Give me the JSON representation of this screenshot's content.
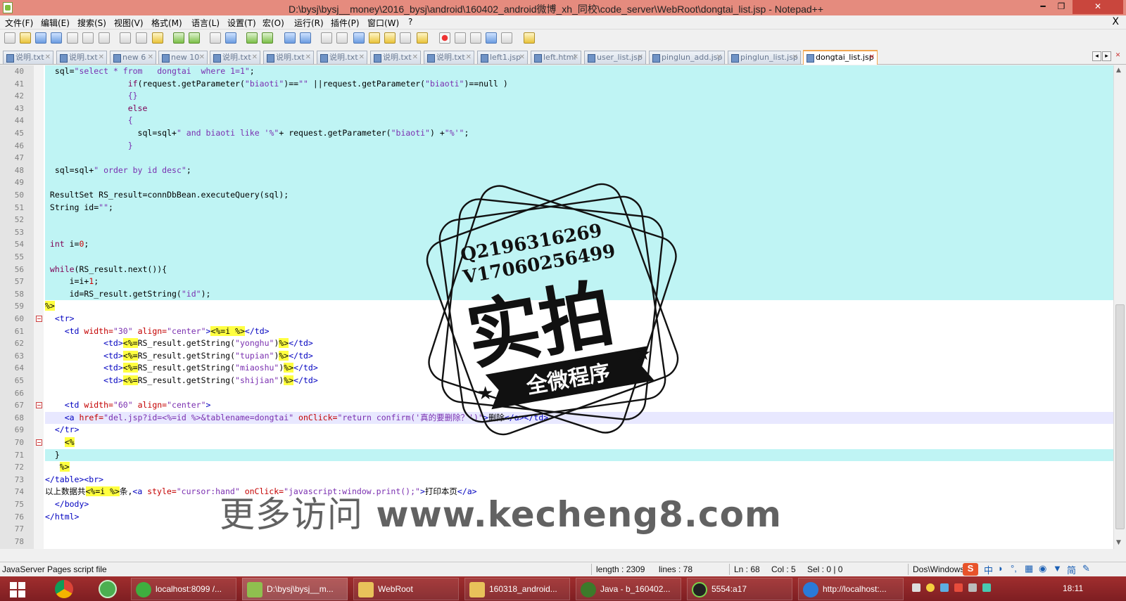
{
  "window": {
    "title": "D:\\bysj\\bysj__money\\2016_bysj\\android\\160402_android微博_xh_同校\\code_server\\WebRoot\\dongtai_list.jsp - Notepad++",
    "minimize": "━",
    "restore": "❐",
    "close": "✕"
  },
  "menu": {
    "items": [
      "文件(F)",
      "编辑(E)",
      "搜索(S)",
      "视图(V)",
      "格式(M)",
      "语言(L)",
      "设置(T)",
      "宏(O)",
      "运行(R)",
      "插件(P)",
      "窗口(W)",
      "?"
    ],
    "close_doc": "X"
  },
  "tabs": [
    {
      "label": "说明.txt"
    },
    {
      "label": "说明.txt"
    },
    {
      "label": "new 6"
    },
    {
      "label": "new 10"
    },
    {
      "label": "说明.txt"
    },
    {
      "label": "说明.txt"
    },
    {
      "label": "说明.txt"
    },
    {
      "label": "说明.txt"
    },
    {
      "label": "说明.txt"
    },
    {
      "label": "left1.jsp"
    },
    {
      "label": "left.html"
    },
    {
      "label": "user_list.jsp"
    },
    {
      "label": "pinglun_add.jsp"
    },
    {
      "label": "pinglun_list.jsp"
    },
    {
      "label": "dongtai_list.jsp",
      "active": true
    }
  ],
  "tab_close_glyph": "✕",
  "tab_nav": {
    "prev": "◂",
    "next": "▸",
    "close": "✕"
  },
  "editor": {
    "lines": [
      {
        "n": "40",
        "hl": true,
        "segs": [
          [
            "tx",
            "  sql="
          ],
          [
            "str",
            "\"select * from   dongtai  where 1=1\""
          ],
          [
            "tx",
            ";"
          ]
        ]
      },
      {
        "n": "41",
        "hl": true,
        "segs": [
          [
            "tx",
            "                 "
          ],
          [
            "kw",
            "if"
          ],
          [
            "tx",
            "(request.getParameter("
          ],
          [
            "str",
            "\"biaoti\""
          ],
          [
            "tx",
            ")=="
          ],
          [
            "str",
            "\"\""
          ],
          [
            "tx",
            " ||request.getParameter("
          ],
          [
            "str",
            "\"biaoti\""
          ],
          [
            "tx",
            ")==null )"
          ]
        ]
      },
      {
        "n": "42",
        "hl": true,
        "segs": [
          [
            "tx",
            "                 "
          ],
          [
            "str",
            "{}"
          ]
        ]
      },
      {
        "n": "43",
        "hl": true,
        "segs": [
          [
            "tx",
            "                 "
          ],
          [
            "kw",
            "else"
          ]
        ]
      },
      {
        "n": "44",
        "hl": true,
        "segs": [
          [
            "tx",
            "                 "
          ],
          [
            "str",
            "{"
          ]
        ]
      },
      {
        "n": "45",
        "hl": true,
        "segs": [
          [
            "tx",
            "                   sql=sql+"
          ],
          [
            "str",
            "\" and biaoti like '%\""
          ],
          [
            "tx",
            "+ request.getParameter("
          ],
          [
            "str",
            "\"biaoti\""
          ],
          [
            "tx",
            ") +"
          ],
          [
            "str",
            "\"%'\""
          ],
          [
            "tx",
            ";"
          ]
        ]
      },
      {
        "n": "46",
        "hl": true,
        "segs": [
          [
            "tx",
            "                 "
          ],
          [
            "str",
            "}"
          ]
        ]
      },
      {
        "n": "47",
        "hl": true,
        "segs": []
      },
      {
        "n": "48",
        "hl": true,
        "segs": [
          [
            "tx",
            "  sql=sql+"
          ],
          [
            "str",
            "\" order by id desc\""
          ],
          [
            "tx",
            ";"
          ]
        ]
      },
      {
        "n": "49",
        "hl": true,
        "segs": []
      },
      {
        "n": "50",
        "hl": true,
        "segs": [
          [
            "tx",
            " ResultSet RS_result=connDbBean.executeQuery(sql);"
          ]
        ]
      },
      {
        "n": "51",
        "hl": true,
        "segs": [
          [
            "tx",
            " String id="
          ],
          [
            "str",
            "\"\""
          ],
          [
            "tx",
            ";"
          ]
        ]
      },
      {
        "n": "52",
        "hl": true,
        "segs": []
      },
      {
        "n": "53",
        "hl": true,
        "segs": []
      },
      {
        "n": "54",
        "hl": true,
        "segs": [
          [
            "kw",
            " int"
          ],
          [
            "tx",
            " i="
          ],
          [
            "num",
            "0"
          ],
          [
            "tx",
            ";"
          ]
        ]
      },
      {
        "n": "55",
        "hl": true,
        "segs": []
      },
      {
        "n": "56",
        "hl": true,
        "segs": [
          [
            "kw",
            " while"
          ],
          [
            "tx",
            "(RS_result.next()){"
          ]
        ]
      },
      {
        "n": "57",
        "hl": true,
        "segs": [
          [
            "tx",
            "     i=i+"
          ],
          [
            "num",
            "1"
          ],
          [
            "tx",
            ";"
          ]
        ]
      },
      {
        "n": "58",
        "hl": true,
        "segs": [
          [
            "tx",
            "     id=RS_result.getString("
          ],
          [
            "str",
            "\"id\""
          ],
          [
            "tx",
            ");"
          ]
        ]
      },
      {
        "n": "59",
        "hl": false,
        "segs": [
          [
            "tk",
            "%>"
          ]
        ]
      },
      {
        "n": "60",
        "hl": false,
        "fold": true,
        "segs": [
          [
            "tag",
            "  <tr>"
          ]
        ]
      },
      {
        "n": "61",
        "hl": false,
        "segs": [
          [
            "tag",
            "    <td "
          ],
          [
            "attr",
            "width="
          ],
          [
            "str",
            "\"30\""
          ],
          [
            "attr",
            " align="
          ],
          [
            "str",
            "\"center\""
          ],
          [
            "tag",
            ">"
          ],
          [
            "tk",
            "<%=i "
          ],
          [
            "tk",
            "%>"
          ],
          [
            "tag",
            "</td>"
          ]
        ]
      },
      {
        "n": "62",
        "hl": false,
        "segs": [
          [
            "tag",
            "            <td>"
          ],
          [
            "tk",
            "<%="
          ],
          [
            "tx",
            "RS_result.getString("
          ],
          [
            "str",
            "\"yonghu\""
          ],
          [
            "tx",
            ")"
          ],
          [
            "tk",
            "%>"
          ],
          [
            "tag",
            "</td>"
          ]
        ]
      },
      {
        "n": "63",
        "hl": false,
        "segs": [
          [
            "tag",
            "            <td>"
          ],
          [
            "tk",
            "<%="
          ],
          [
            "tx",
            "RS_result.getString("
          ],
          [
            "str",
            "\"tupian\""
          ],
          [
            "tx",
            ")"
          ],
          [
            "tk",
            "%>"
          ],
          [
            "tag",
            "</td>"
          ]
        ]
      },
      {
        "n": "64",
        "hl": false,
        "segs": [
          [
            "tag",
            "            <td>"
          ],
          [
            "tk",
            "<%="
          ],
          [
            "tx",
            "RS_result.getString("
          ],
          [
            "str",
            "\"miaoshu\""
          ],
          [
            "tx",
            ")"
          ],
          [
            "tk",
            "%>"
          ],
          [
            "tag",
            "</td>"
          ]
        ]
      },
      {
        "n": "65",
        "hl": false,
        "segs": [
          [
            "tag",
            "            <td>"
          ],
          [
            "tk",
            "<%="
          ],
          [
            "tx",
            "RS_result.getString("
          ],
          [
            "str",
            "\"shijian\""
          ],
          [
            "tx",
            ")"
          ],
          [
            "tk",
            "%>"
          ],
          [
            "tag",
            "</td>"
          ]
        ]
      },
      {
        "n": "66",
        "hl": false,
        "segs": []
      },
      {
        "n": "67",
        "hl": false,
        "fold": true,
        "segs": [
          [
            "tag",
            "    <td "
          ],
          [
            "attr",
            "width="
          ],
          [
            "str",
            "\"60\""
          ],
          [
            "attr",
            " align="
          ],
          [
            "str",
            "\"center\""
          ],
          [
            "tag",
            ">"
          ]
        ]
      },
      {
        "n": "68",
        "hl": false,
        "cur": true,
        "segs": [
          [
            "tag",
            "    <a "
          ],
          [
            "attr",
            "href="
          ],
          [
            "str",
            "\"del.jsp?id=<%=id %>&tablename=dongtai\""
          ],
          [
            "attr",
            " onClick="
          ],
          [
            "str",
            "\"return confirm('真的要删除？')\""
          ],
          [
            "tag",
            ">"
          ],
          [
            "tx",
            "删除"
          ],
          [
            "tag",
            "</a></td>"
          ]
        ]
      },
      {
        "n": "69",
        "hl": false,
        "segs": [
          [
            "tag",
            "  </tr>"
          ]
        ]
      },
      {
        "n": "70",
        "hl": false,
        "fold": true,
        "segs": [
          [
            "tx",
            "    "
          ],
          [
            "tk",
            "<%"
          ]
        ]
      },
      {
        "n": "71",
        "hl": true,
        "segs": [
          [
            "tx",
            "  }"
          ]
        ]
      },
      {
        "n": "72",
        "hl": false,
        "segs": [
          [
            "tx",
            "   "
          ],
          [
            "tk",
            "%>"
          ]
        ]
      },
      {
        "n": "73",
        "hl": false,
        "segs": [
          [
            "tag",
            "</table><br>"
          ]
        ]
      },
      {
        "n": "74",
        "hl": false,
        "segs": [
          [
            "tx",
            "以上数据共"
          ],
          [
            "tk",
            "<%=i "
          ],
          [
            "tk",
            "%>"
          ],
          [
            "tx",
            "条,"
          ],
          [
            "tag",
            "<a "
          ],
          [
            "attr",
            "style="
          ],
          [
            "str",
            "\"cursor:hand\""
          ],
          [
            "attr",
            " onClick="
          ],
          [
            "str",
            "\"javascript:window.print();\""
          ],
          [
            "tag",
            ">"
          ],
          [
            "tx",
            "打印本页"
          ],
          [
            "tag",
            "</a>"
          ]
        ]
      },
      {
        "n": "75",
        "hl": false,
        "segs": [
          [
            "tag",
            "  </body>"
          ]
        ]
      },
      {
        "n": "76",
        "hl": false,
        "segs": [
          [
            "tag",
            "</html>"
          ]
        ]
      },
      {
        "n": "77",
        "hl": false,
        "segs": []
      },
      {
        "n": "78",
        "hl": false,
        "segs": []
      }
    ]
  },
  "status": {
    "filetype": "JavaServer Pages script file",
    "length": "length : 2309",
    "lines": "lines : 78",
    "ln": "Ln : 68",
    "col": "Col : 5",
    "sel": "Sel : 0 | 0",
    "eol": "Dos\\Windows"
  },
  "taskbar": {
    "items": [
      {
        "label": "localhost:8099 /...",
        "color": "#3fae3f"
      },
      {
        "label": "D:\\bysj\\bysj__m...",
        "color": "#8fbf4f"
      },
      {
        "label": "WebRoot",
        "color": "#e8c25a"
      },
      {
        "label": "160318_android...",
        "color": "#e8c25a"
      },
      {
        "label": "Java - b_160402...",
        "color": "#3c7a2a"
      },
      {
        "label": "5554:a17",
        "color": "#222222"
      },
      {
        "label": "http://localhost:...",
        "color": "#2a7ad8"
      }
    ],
    "clock": "18:11"
  },
  "stamp": {
    "line1": "Q2196316269",
    "line2": "V17060256499",
    "big": "实拍",
    "ribbon": "全微程序"
  },
  "watermark": {
    "prefix": "更多访问",
    "site": "www.kecheng8.com"
  },
  "colors": {
    "titlebar": "#e58b7e",
    "current_line": "#e8e8ff",
    "highlight": "#bff4f4",
    "jsp_token": "#ffff40",
    "taskbar": "#8e2428"
  }
}
